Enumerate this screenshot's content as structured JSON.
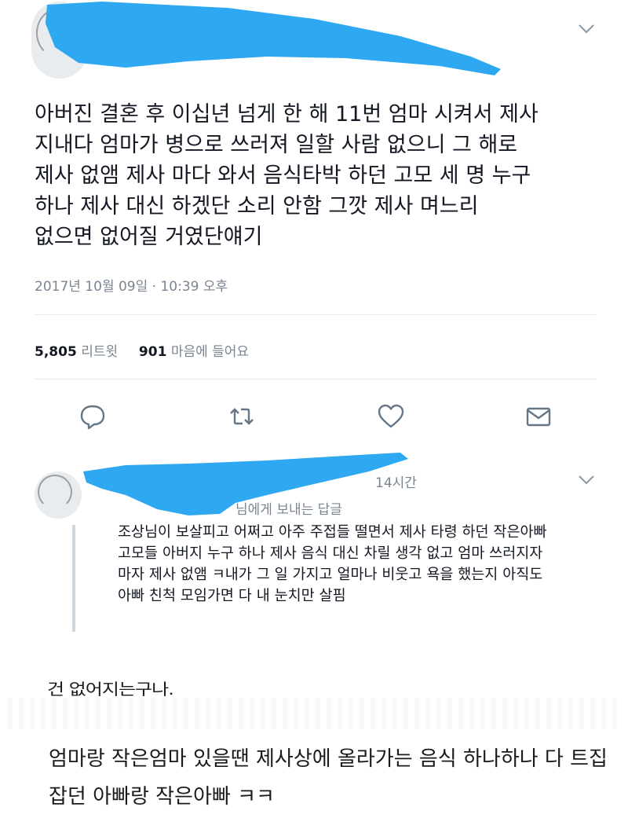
{
  "tweet": {
    "text_lines": [
      "아버진 결혼 후 이십년 넘게 한 해 11번 엄마 시켜서 제사",
      "지내다 엄마가 병으로 쓰러져 일할 사람 없으니 그 해로",
      "제사 없앰 제사 마다 와서 음식타박 하던 고모 세 명 누구",
      "하나 제사 대신 하겠단 소리 안함 그깟 제사 며느리",
      "없으면 없어질 거였단얘기"
    ],
    "timestamp": "2017년 10월 09일 · 10:39 오후",
    "stats": {
      "retweet_count": "5,805",
      "retweet_label": "리트윗",
      "like_count": "901",
      "like_label": "마음에 들어요"
    },
    "actions": [
      "reply-icon",
      "retweet-icon",
      "heart-icon",
      "mail-icon"
    ]
  },
  "reply": {
    "time": "14시간",
    "replying_to": "님에게 보내는 답글",
    "text_lines": [
      "조상님이 보살피고 어쩌고 아주 주접들 떨면서 제사 타령 하던 작은아빠",
      "고모들 아버지 누구 하나 제사 음식 대신 차릴 생각 없고 엄마 쓰러지자",
      "마자 제사 없앰 ㅋ내가 그 일 가지고 얼마나 비웃고 욕을 했는지 아직도",
      "아빠 친척 모임가면 다 내 눈치만 살핌"
    ]
  },
  "lower": {
    "partial_line": "건 없어지는구나.",
    "text_lines": [
      "엄마랑 작은엄마 있을땐 제사상에 올라가는 음식 하나하나 다 트집",
      "잡던 아빠랑 작은아빠 ㅋㅋ"
    ]
  },
  "colors": {
    "redaction": "#2ea8f0",
    "secondary_text": "#7a8591",
    "divider": "#e6ecf0",
    "thread_line": "#cfd6db"
  }
}
